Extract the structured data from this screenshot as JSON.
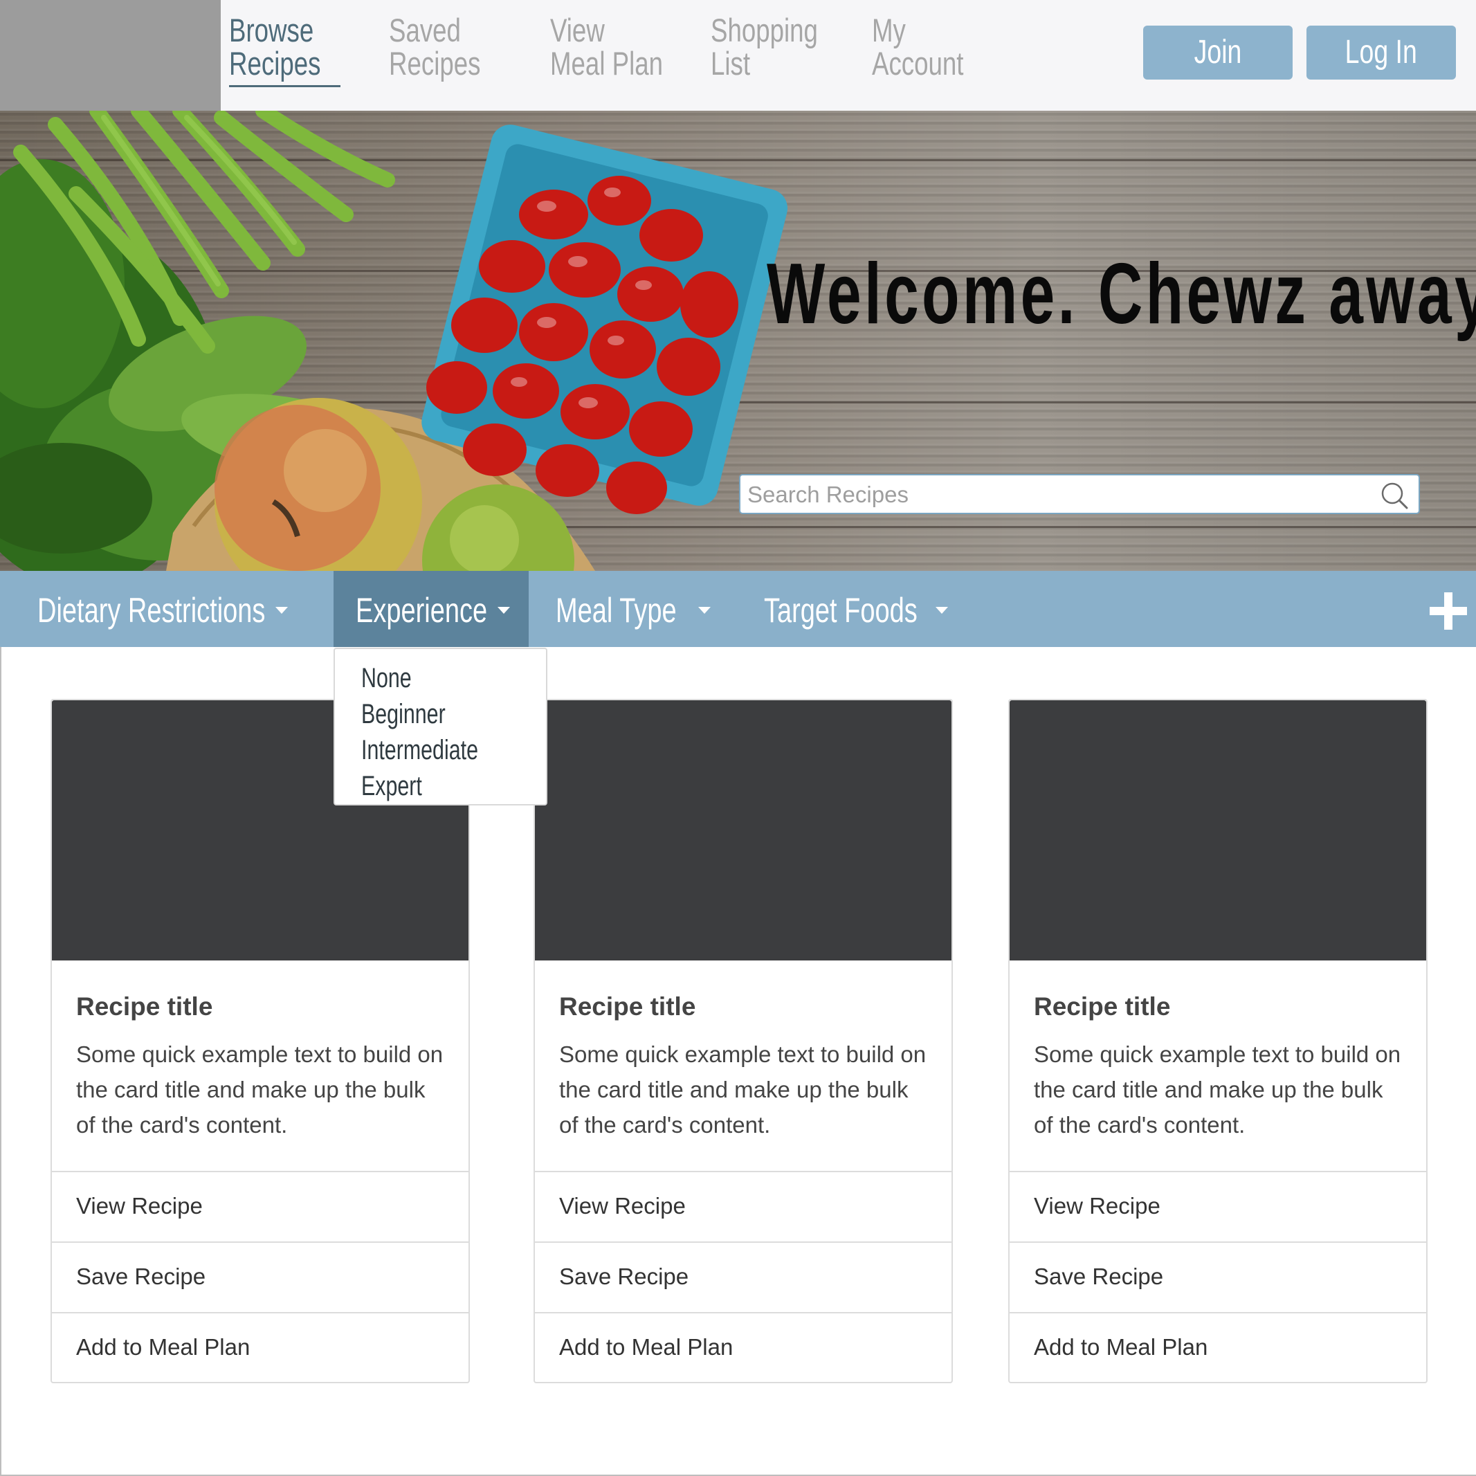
{
  "nav": {
    "items": [
      {
        "line1": "Browse",
        "line2": "Recipes",
        "active": true
      },
      {
        "line1": "Saved",
        "line2": "Recipes",
        "active": false
      },
      {
        "line1": "View",
        "line2": "Meal Plan",
        "active": false
      },
      {
        "line1": "Shopping",
        "line2": "List",
        "active": false
      },
      {
        "line1": "My",
        "line2": "Account",
        "active": false
      }
    ],
    "join_label": "Join",
    "login_label": "Log In"
  },
  "hero": {
    "title": "Welcome. Chewz away!",
    "search": {
      "placeholder": "Search Recipes",
      "value": ""
    }
  },
  "filters": {
    "items": [
      {
        "label": "Dietary Restrictions",
        "open": false
      },
      {
        "label": "Experience",
        "open": true
      },
      {
        "label": "Meal Type",
        "open": false
      },
      {
        "label": "Target Foods",
        "open": false
      }
    ],
    "experience_options": [
      "None",
      "Beginner",
      "Intermediate",
      "Expert"
    ]
  },
  "cards": [
    {
      "title": "Recipe title",
      "text": "Some quick example text to build on the card title and make up the bulk of the card's content.",
      "actions": [
        "View Recipe",
        "Save Recipe",
        "Add to Meal Plan"
      ]
    },
    {
      "title": "Recipe title",
      "text": "Some quick example text to build on the card title and make up the bulk of the card's content.",
      "actions": [
        "View Recipe",
        "Save Recipe",
        "Add to Meal Plan"
      ]
    },
    {
      "title": "Recipe title",
      "text": "Some quick example text to build on the card title and make up the bulk of the card's content.",
      "actions": [
        "View Recipe",
        "Save Recipe",
        "Add to Meal Plan"
      ]
    }
  ],
  "colors": {
    "nav_active": "#4e6b7a",
    "nav_inactive": "#a6a6a6",
    "accent_blue": "#8db3cd",
    "filter_bar": "#8ab0ca",
    "filter_open": "#5c839c",
    "card_image": "#3c3d3f"
  },
  "icons": {
    "search": "search-icon",
    "caret": "chevron-down-icon",
    "plus": "plus-icon"
  }
}
